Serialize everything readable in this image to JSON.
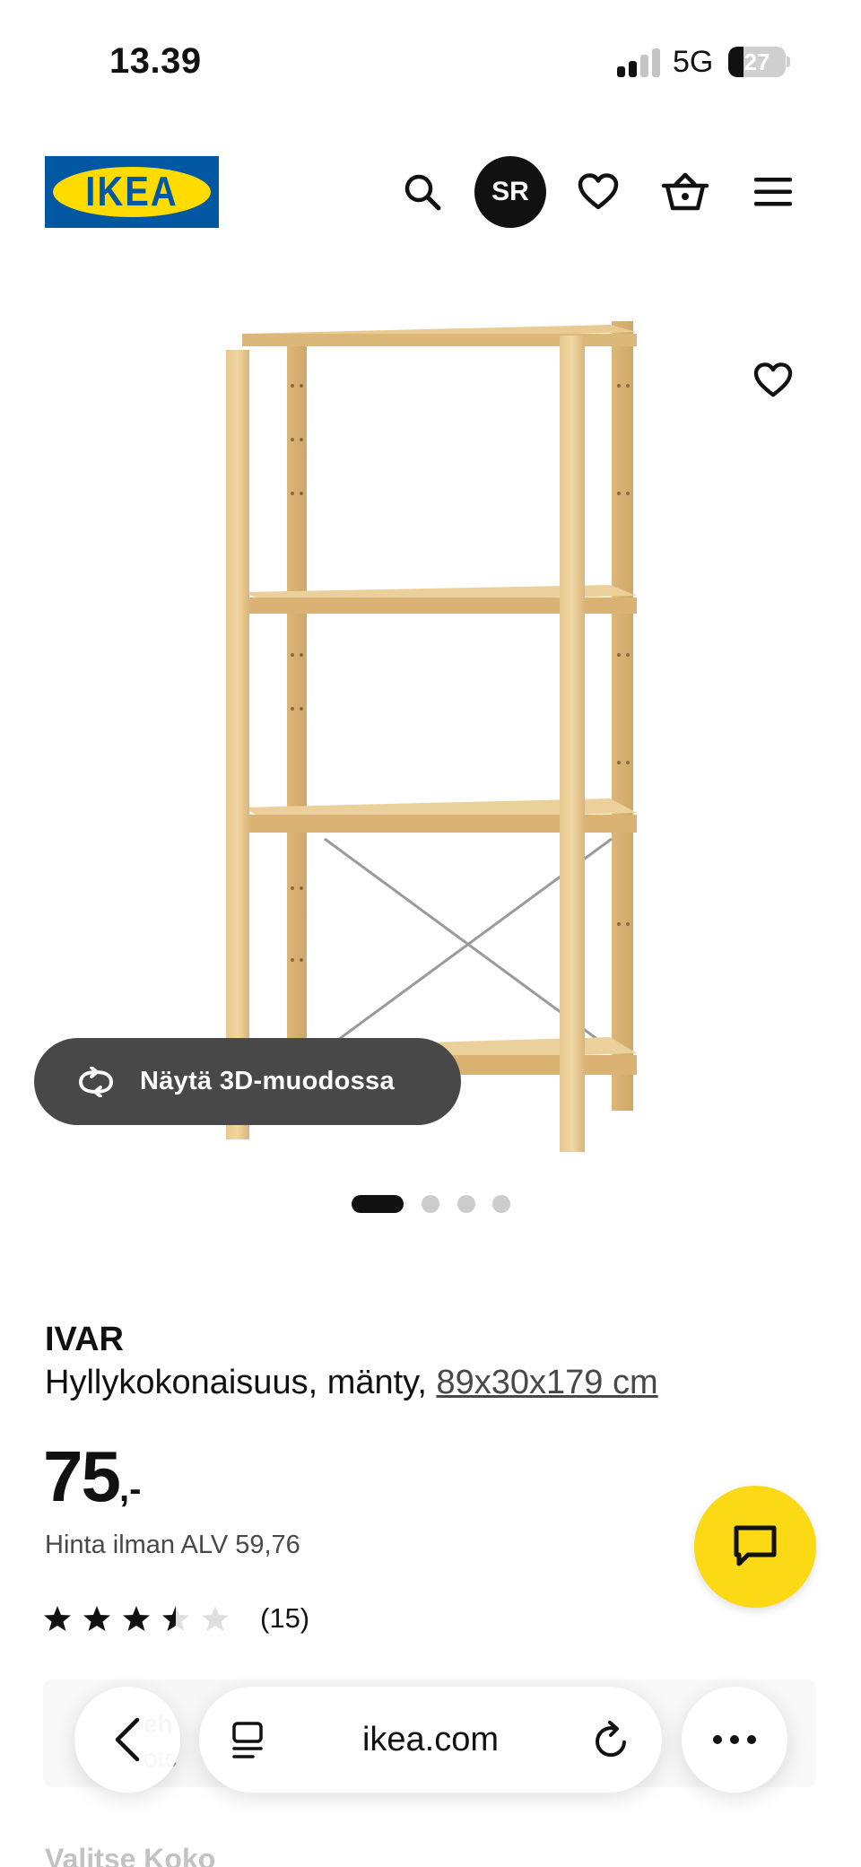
{
  "status_bar": {
    "time": "13.39",
    "network": "5G",
    "battery": "27",
    "battery_level": 0.27
  },
  "header": {
    "logo_text": "IKEA",
    "avatar_initials": "SR",
    "icons": [
      "search-icon",
      "heart-icon",
      "basket-icon",
      "menu-icon"
    ]
  },
  "gallery": {
    "view_3d_label": "Näytä 3D-muodossa",
    "image_count": 4,
    "active_index": 0
  },
  "product": {
    "name": "IVAR",
    "description": "Hyllykokonaisuus, mänty,",
    "size_link": "89x30x179 cm",
    "price_main": "75",
    "price_suffix": ",-",
    "price_vat": "Hinta ilman ALV 59,76",
    "rating_value": 3.5,
    "rating_max": 5,
    "review_count": "(15)"
  },
  "background_content": {
    "info_title": "eh",
    "info_sub": "otc",
    "choose_size": "Valitse Koko"
  },
  "browser": {
    "url": "ikea.com"
  },
  "colors": {
    "ikea_blue": "#0058a3",
    "ikea_yellow": "#ffdb00",
    "chat_yellow": "#fbd914",
    "text": "#111111"
  }
}
